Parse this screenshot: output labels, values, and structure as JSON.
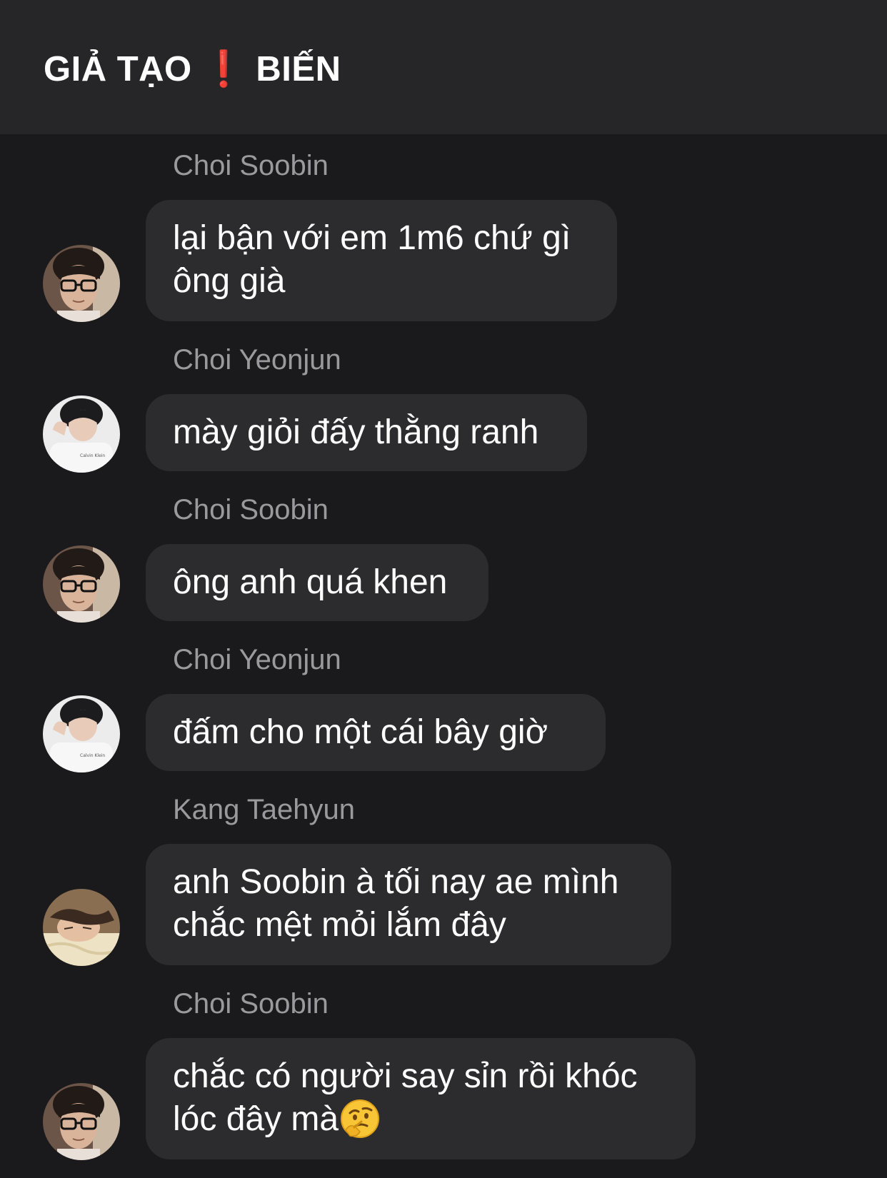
{
  "header": {
    "title": "GIẢ TẠO ❗ BIẾN"
  },
  "messages": [
    {
      "sender": "Choi Soobin",
      "text": "lại bận với em 1m6 chứ gì ông già",
      "avatar": "soobin-avatar"
    },
    {
      "sender": "Choi Yeonjun",
      "text": "mày giỏi đấy thằng ranh",
      "avatar": "yeonjun-avatar"
    },
    {
      "sender": "Choi Soobin",
      "text": "ông anh quá khen",
      "avatar": "soobin-avatar"
    },
    {
      "sender": "Choi Yeonjun",
      "text": "đấm cho một cái bây giờ",
      "avatar": "yeonjun-avatar"
    },
    {
      "sender": "Kang Taehyun",
      "text": "anh Soobin à tối nay ae mình chắc mệt mỏi lắm đây",
      "avatar": "taehyun-avatar"
    },
    {
      "sender": "Choi Soobin",
      "text": "chắc có người say sỉn rồi khóc lóc đây mà",
      "avatar": "soobin-avatar",
      "emoji": "thinking-face-icon"
    }
  ],
  "colors": {
    "background": "#1a1a1c",
    "header": "#262628",
    "bubble": "#2c2c2e",
    "sender_text": "#9a9a9e",
    "message_text": "#ffffff",
    "exclamation": "#e0262b"
  }
}
